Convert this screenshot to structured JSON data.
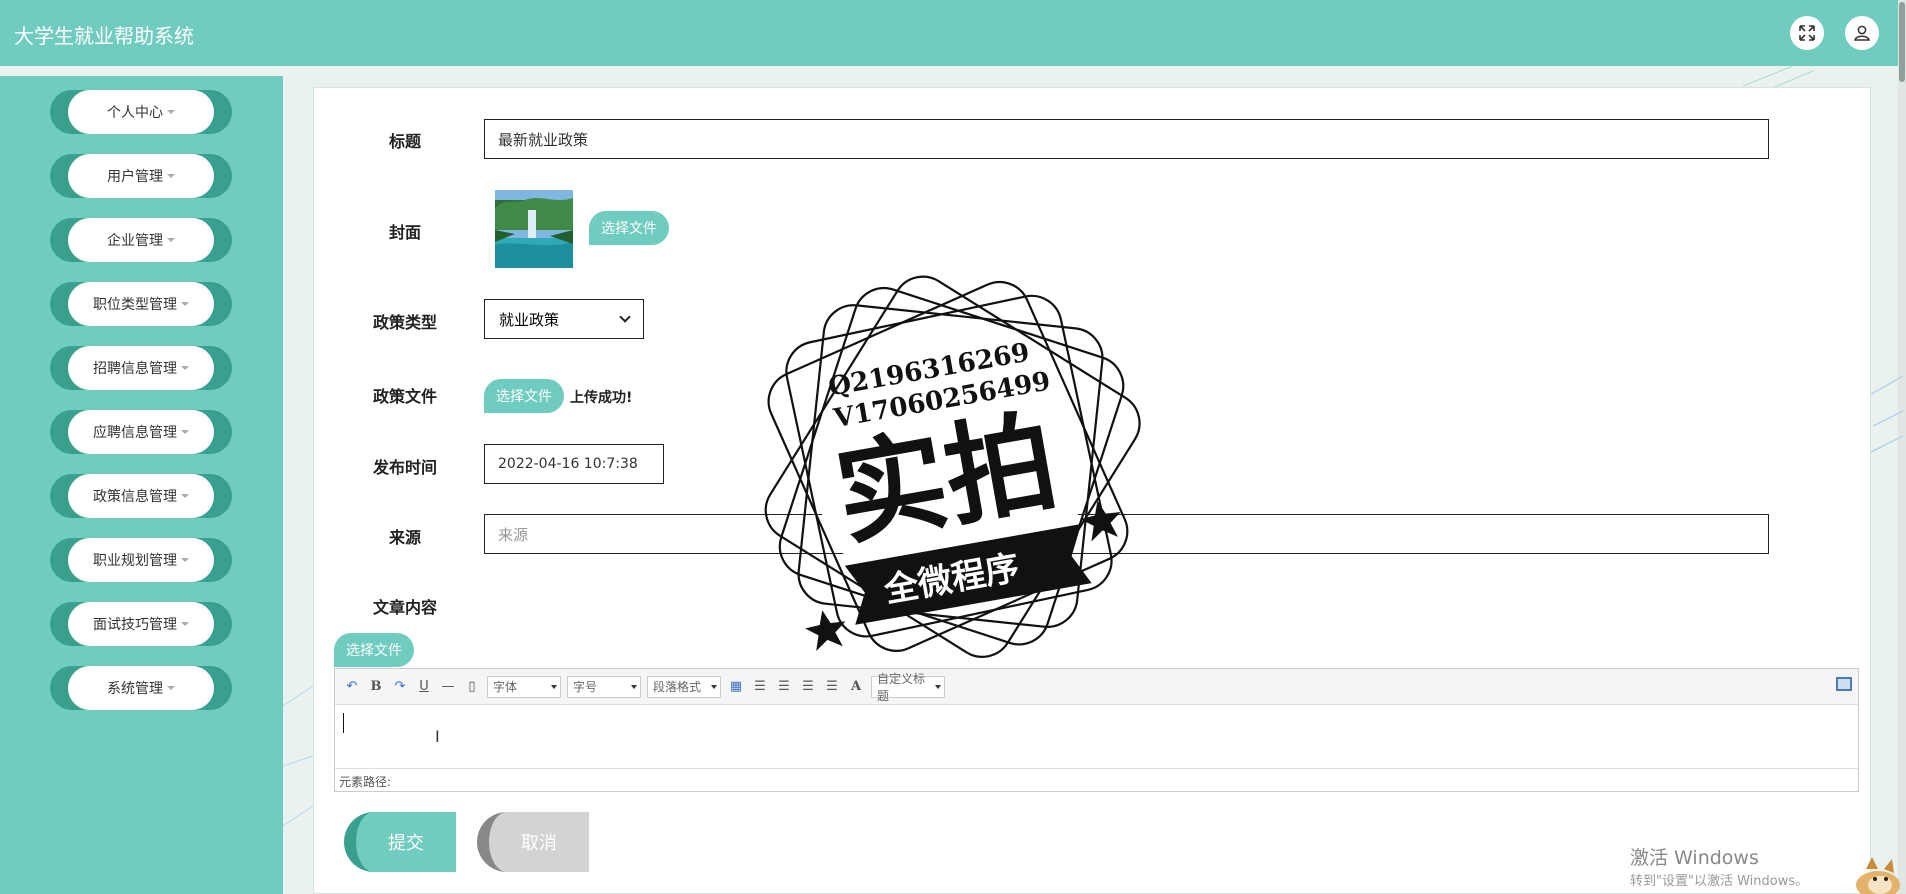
{
  "app": {
    "title": "大学生就业帮助系统"
  },
  "header_icons": {
    "expand": "fullscreen-icon",
    "user": "user-icon"
  },
  "sidebar": {
    "items": [
      {
        "label": "个人中心"
      },
      {
        "label": "用户管理"
      },
      {
        "label": "企业管理"
      },
      {
        "label": "职位类型管理"
      },
      {
        "label": "招聘信息管理"
      },
      {
        "label": "应聘信息管理"
      },
      {
        "label": "政策信息管理"
      },
      {
        "label": "职业规划管理"
      },
      {
        "label": "面试技巧管理"
      },
      {
        "label": "系统管理"
      }
    ]
  },
  "form": {
    "title": {
      "label": "标题",
      "value": "最新就业政策"
    },
    "cover": {
      "label": "封面",
      "button": "选择文件"
    },
    "policy_type": {
      "label": "政策类型",
      "value": "就业政策"
    },
    "policy_file": {
      "label": "政策文件",
      "button": "选择文件",
      "status": "上传成功!"
    },
    "publish_time": {
      "label": "发布时间",
      "value": "2022-04-16 10:7:38"
    },
    "source": {
      "label": "来源",
      "placeholder": "来源"
    },
    "content": {
      "label": "文章内容",
      "button": "选择文件"
    }
  },
  "editor": {
    "toolbar": {
      "font": "字体",
      "size": "字号",
      "paragraph": "段落格式",
      "custom_title": "自定义标题"
    },
    "element_path": "元素路径:"
  },
  "actions": {
    "submit": "提交",
    "cancel": "取消"
  },
  "watermark": {
    "line1": "Q2196316269",
    "line2": "V17060256499",
    "big": "实拍",
    "banner": "全微程序"
  },
  "os_notice": {
    "title": "激活 Windows",
    "subtitle": "转到\"设置\"以激活 Windows。"
  },
  "colors": {
    "accent": "#6fccbf",
    "accent_dark": "#3aa08e",
    "cancel": "#d3d3d3"
  }
}
